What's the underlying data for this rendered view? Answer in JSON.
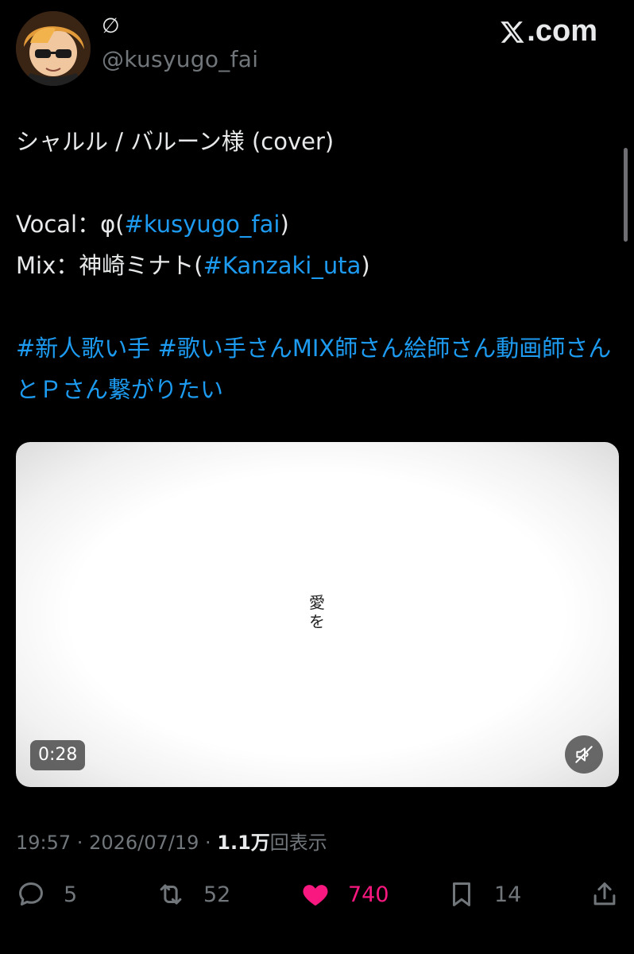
{
  "author": {
    "display_name": "∅",
    "handle": "@kusyugo_fai"
  },
  "brand": {
    "text": ".com",
    "icon": "x-logo-icon"
  },
  "tweet": {
    "line1": "シャルル / バルーン様 (cover)",
    "vocal_label": "Vocal：φ(",
    "vocal_link": "#kusyugo_fai",
    "vocal_end": ")",
    "mix_label": "Mix：神崎ミナト(",
    "mix_link": "#Kanzaki_uta",
    "mix_end": ")",
    "hashtags": "#新人歌い手 #歌い手さんMIX師さん絵師さん動画師さんとＰさん繋がりたい"
  },
  "video": {
    "caption": "愛を",
    "duration": "0:28",
    "mute_icon": "speaker-muted-icon"
  },
  "meta": {
    "time": "19:57",
    "sep1": " · ",
    "date": "2026/07/19",
    "sep2": " · ",
    "views_count": "1.1万",
    "views_label": "回表示"
  },
  "actions": {
    "replies": "5",
    "retweets": "52",
    "likes": "740",
    "bookmarks": "14"
  },
  "colors": {
    "background": "#000000",
    "text": "#e7e9ea",
    "secondary": "#71767b",
    "link": "#1d9bf0",
    "like": "#f91880"
  }
}
